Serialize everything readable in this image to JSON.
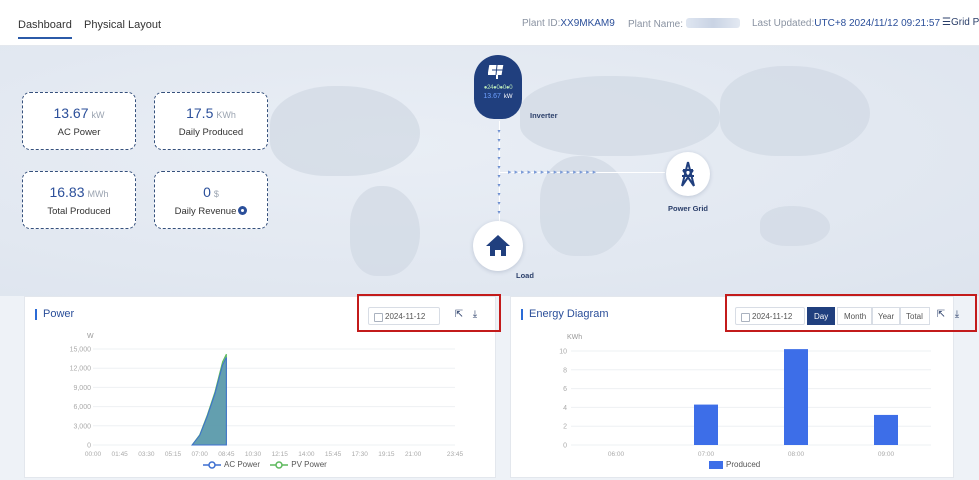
{
  "nav": {
    "tabs": [
      {
        "label": "Dashboard",
        "active": true
      },
      {
        "label": "Physical Layout",
        "active": false
      }
    ],
    "plant_id_label": "Plant ID:",
    "plant_id": "XX9MKAM9",
    "plant_name_label": "Plant Name:",
    "last_updated_label": "Last Updated:",
    "last_updated": "UTC+8 2024/11/12 09:21:57",
    "grid_button": "Grid Pr"
  },
  "stats": [
    {
      "value": "13.67",
      "unit": "kW",
      "label": "AC Power"
    },
    {
      "value": "17.5",
      "unit": "KWh",
      "label": "Daily Produced"
    },
    {
      "value": "16.83",
      "unit": "MWh",
      "label": "Total Produced"
    },
    {
      "value": "0",
      "unit": "$",
      "label": "Daily Revenue"
    }
  ],
  "flow": {
    "inverter_led": "●24●0●0●0",
    "inverter_power": "13.67",
    "inverter_power_unit": "kW",
    "inverter_label": "Inverter",
    "grid_label": "Power Grid",
    "load_label": "Load"
  },
  "power_panel": {
    "title": "Power",
    "date": "2024-11-12"
  },
  "energy_panel": {
    "title": "Energy Diagram",
    "date": "2024-11-12",
    "periods": [
      "Day",
      "Month",
      "Year",
      "Total"
    ],
    "active_period": "Day"
  },
  "colors": {
    "accent": "#203f7e",
    "title_blue": "#2b4f9a",
    "highlight_red": "#c31b1b",
    "ac_power": "#3d6fd1",
    "pv_power": "#5cb85c",
    "bar": "#3d6ee8"
  },
  "chart_data": [
    {
      "type": "area",
      "title": "Power",
      "ylabel": "W",
      "ylim": [
        0,
        15000
      ],
      "yticks": [
        "15,000",
        "12,000",
        "9,000",
        "6,000",
        "3,000",
        "0"
      ],
      "categories": [
        "00:00",
        "01:45",
        "03:30",
        "05:15",
        "07:00",
        "08:45",
        "10:30",
        "12:15",
        "14:00",
        "15:45",
        "17:30",
        "19:15",
        "21:00",
        "23:45"
      ],
      "series": [
        {
          "name": "AC Power",
          "x": [
            "06:30",
            "07:00",
            "07:30",
            "08:00",
            "08:30",
            "08:45"
          ],
          "values": [
            0,
            1500,
            4500,
            8000,
            12500,
            13700
          ]
        },
        {
          "name": "PV Power",
          "x": [
            "06:30",
            "07:00",
            "07:30",
            "08:00",
            "08:30",
            "08:45"
          ],
          "values": [
            0,
            1600,
            4700,
            8300,
            13000,
            14200
          ]
        }
      ],
      "legend": "bottom"
    },
    {
      "type": "bar",
      "title": "Energy Diagram",
      "ylabel": "KWh",
      "ylim": [
        0,
        10
      ],
      "yticks": [
        "10",
        "8",
        "6",
        "4",
        "2",
        "0"
      ],
      "categories": [
        "06:00",
        "07:00",
        "08:00",
        "09:00"
      ],
      "series": [
        {
          "name": "Produced",
          "values": [
            0,
            4.3,
            10.2,
            3.2
          ]
        }
      ],
      "legend": "bottom"
    }
  ]
}
